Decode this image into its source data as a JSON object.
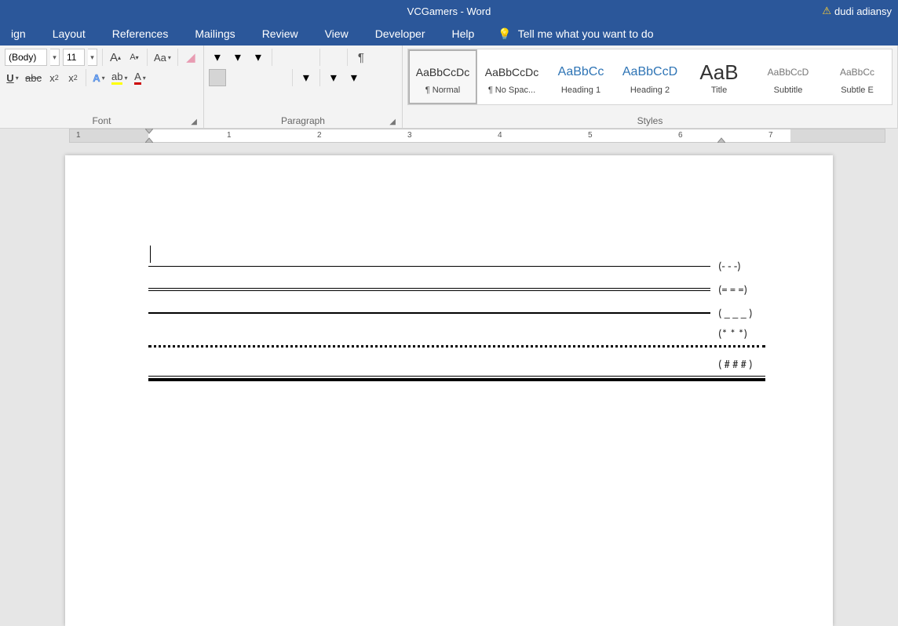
{
  "titlebar": {
    "title": "VCGamers  -  Word",
    "user": "dudi adiansy"
  },
  "menubar": {
    "tabs": [
      "ign",
      "Layout",
      "References",
      "Mailings",
      "Review",
      "View",
      "Developer",
      "Help"
    ],
    "tellme": "Tell me what you want to do"
  },
  "font": {
    "group_label": "Font",
    "name": "(Body)",
    "size": "11",
    "grow": "A",
    "shrink": "A",
    "case": "Aa",
    "underline": "U",
    "strike": "abc",
    "sub": "x",
    "sub_idx": "2",
    "sup": "x",
    "sup_idx": "2",
    "effects": "A",
    "highlight": "ab",
    "color": "A"
  },
  "paragraph": {
    "group_label": "Paragraph"
  },
  "styles": {
    "group_label": "Styles",
    "items": [
      {
        "preview": "AaBbCcDc",
        "name": "¶ Normal",
        "kind": "normal",
        "selected": true
      },
      {
        "preview": "AaBbCcDc",
        "name": "¶ No Spac...",
        "kind": "normal"
      },
      {
        "preview": "AaBbCc",
        "name": "Heading 1",
        "kind": "blue"
      },
      {
        "preview": "AaBbCcD",
        "name": "Heading 2",
        "kind": "blue"
      },
      {
        "preview": "AaB",
        "name": "Title",
        "kind": "title"
      },
      {
        "preview": "AaBbCcD",
        "name": "Subtitle",
        "kind": "subtle"
      },
      {
        "preview": "AaBbCc",
        "name": "Subtle E",
        "kind": "subtle"
      }
    ]
  },
  "ruler": {
    "numbers": [
      "1",
      "1",
      "2",
      "3",
      "4",
      "5",
      "6",
      "7"
    ]
  },
  "doc": {
    "lines": [
      {
        "type": "thin",
        "label": "(- - -)"
      },
      {
        "type": "double",
        "label": "(= = =)"
      },
      {
        "type": "thick",
        "label": "( _ _ _ )"
      },
      {
        "type": "stars",
        "label": "(* * *)"
      },
      {
        "type": "dotted",
        "label": ""
      },
      {
        "type": "hash",
        "label": "( # # # )"
      },
      {
        "type": "triple",
        "label": ""
      }
    ]
  }
}
